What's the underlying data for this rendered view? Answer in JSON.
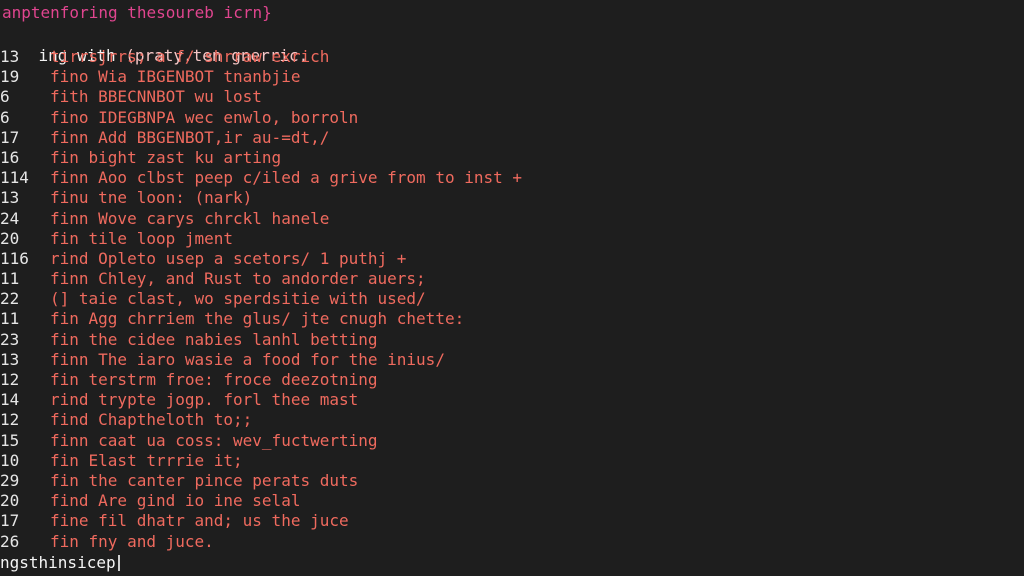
{
  "title": "anptenforing thesoureb icrn}",
  "subtitle": {
    "prefix": "ing with ",
    "highlight": "(praty.ten gnerric."
  },
  "lines": [
    {
      "num": "13",
      "text": "tirrsjrrs; a f/ shrraw exrich"
    },
    {
      "num": "19",
      "text": "fino Wia IBGENBOT tnanbjie"
    },
    {
      "num": "6",
      "text": "fith BBECNNBOT wu lost"
    },
    {
      "num": "6",
      "text": "fino IDEGBNPA wec enwlo, borroln"
    },
    {
      "num": "17",
      "text": "finn Add BBGENBOT,ir au-=dt,/"
    },
    {
      "num": "16",
      "text": "fin bight zast ku arting"
    },
    {
      "num": "114",
      "text": "finn Aoo clbst peep c/iled a grive from to inst +"
    },
    {
      "num": "13",
      "text": "finu tne loon: (nark)"
    },
    {
      "num": "24",
      "text": "finn Wove carys chrckl hanele"
    },
    {
      "num": "20",
      "text": "fin tile loop jment"
    },
    {
      "num": "116",
      "text": "rind Opleto usep a scetors/ 1 puthj +"
    },
    {
      "num": "11",
      "text": "finn Chley, and Rust to andorder auers;"
    },
    {
      "num": "22",
      "text": "(] taie clast, wo sperdsitie with used/"
    },
    {
      "num": "11",
      "text": "fin Agg chrriem the glus/ jte cnugh chette:"
    },
    {
      "num": "23",
      "text": "fin the cidee nabies lanhl betting"
    },
    {
      "num": "13",
      "text": "finn The iaro wasie a food for the inius/"
    },
    {
      "num": "12",
      "text": "fin terstrm froe: froce deezotning"
    },
    {
      "num": "14",
      "text": "rind trypte jogp. forl thee mast"
    },
    {
      "num": "12",
      "text": "find Chaptheloth to;;"
    },
    {
      "num": "15",
      "text": "finn caat ua coss: wev_fuctwerting"
    },
    {
      "num": "10",
      "text": "fin Elast trrrie it;"
    },
    {
      "num": "29",
      "text": "fin the canter pince perats duts"
    },
    {
      "num": "20",
      "text": "find Are gind io ine selal"
    },
    {
      "num": "17",
      "text": "fine fil dhatr and; us the juce"
    },
    {
      "num": "26",
      "text": "fin fny and juce."
    }
  ],
  "command_line": "ngsthinsicep"
}
